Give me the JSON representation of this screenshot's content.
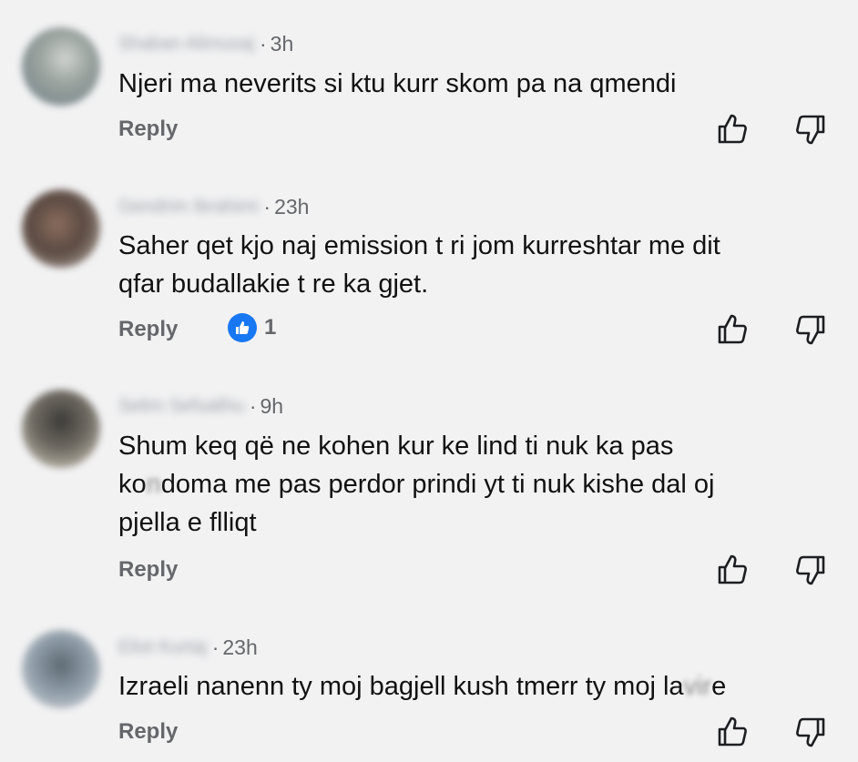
{
  "comments": [
    {
      "author": "Shaban Alimusaj",
      "time": "3h",
      "text": "Njeri ma neverits si ktu kurr skom pa na qmendi",
      "reply_label": "Reply",
      "avatar_colors": [
        "#6f7d86",
        "#cfd3cf"
      ]
    },
    {
      "author": "Gendrim Ibrahimi",
      "time": "23h",
      "text_line1": "Saher qet kjo naj emission t ri jom kurreshtar me dit",
      "text_line2": "qfar budallakie t re ka gjet.",
      "reply_label": "Reply",
      "reaction_count": "1",
      "avatar_colors": [
        "#5b4a42",
        "#bfb7ad"
      ]
    },
    {
      "author": "Selim Sefsalihu",
      "time": "9h",
      "text_line1": "Shum keq që ne kohen kur ke lind ti nuk ka pas",
      "text_line2_a": "ko",
      "text_line2_blur": "n",
      "text_line2_b": "doma me pas perdor prindi yt ti nuk kishe dal oj",
      "text_line3": "pjella e flliqt",
      "reply_label": "Reply",
      "avatar_colors": [
        "#3d3b38",
        "#d9d2c4"
      ]
    },
    {
      "author": "Eliot Kurtaj",
      "time": "23h",
      "text_a": "Izraeli nanenn ty moj bagjell kush tmerr ty moj la",
      "text_blur": "vir",
      "text_b": "e",
      "reply_label": "Reply",
      "avatar_colors": [
        "#8c9aa6",
        "#d6d9dc"
      ]
    }
  ],
  "time_separator": "·"
}
